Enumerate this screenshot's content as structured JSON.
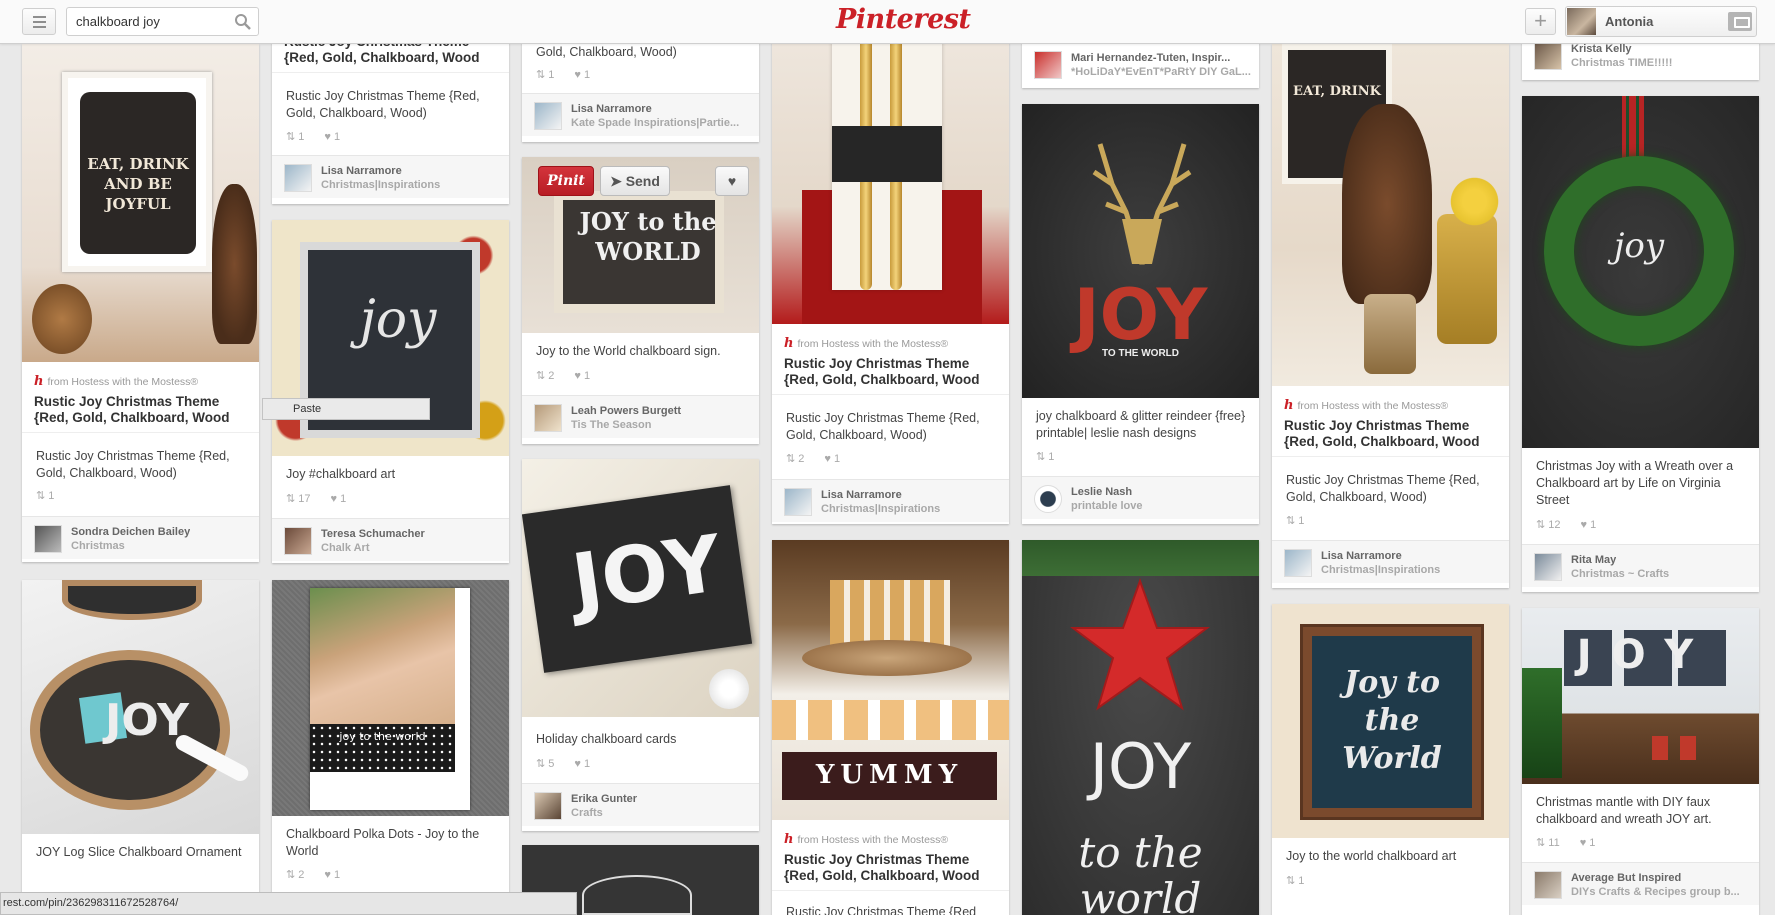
{
  "header": {
    "search_value": "chalkboard joy",
    "logo": "Pinterest",
    "user_name": "Antonia"
  },
  "hover_actions": {
    "pin_it": "Pinit",
    "send": "Send"
  },
  "paste_tooltip": "Paste",
  "status_url": "rest.com/pin/236298311672528764/",
  "pins": {
    "c1a": {
      "source": "from Hostess with the Mostess®",
      "title": "Rustic Joy Christmas Theme {Red, Gold, Chalkboard, Wood",
      "desc": "Rustic Joy Christmas Theme {Red, Gold, Chalkboard, Wood)",
      "repins": "1",
      "user": "Sondra Deichen Bailey",
      "board": "Christmas",
      "img_text": "EAT, DRINK AND BE JOYFUL"
    },
    "c1b": {
      "desc": "JOY Log Slice Chalkboard Ornament",
      "img_text": "JOY"
    },
    "c2a": {
      "title": "Rustic Joy Christmas Theme {Red, Gold, Chalkboard, Wood",
      "desc": "Rustic Joy Christmas Theme {Red, Gold, Chalkboard, Wood)",
      "repins": "1",
      "likes": "1",
      "user": "Lisa Narramore",
      "board": "Christmas|Inspirations"
    },
    "c2b": {
      "desc": "Joy #chalkboard art",
      "repins": "17",
      "likes": "1",
      "user": "Teresa Schumacher",
      "board": "Chalk Art",
      "img_text": "joy"
    },
    "c2c": {
      "desc": "Chalkboard Polka Dots - Joy to the World",
      "repins": "2",
      "likes": "1",
      "img_text": "joy to the world"
    },
    "c3a": {
      "desc": "Gold, Chalkboard, Wood)",
      "repins": "1",
      "likes": "1",
      "user": "Lisa Narramore",
      "board": "Kate Spade Inspirations|Partie..."
    },
    "c3b": {
      "desc": "Joy to the World chalkboard sign.",
      "repins": "2",
      "likes": "1",
      "user": "Leah Powers Burgett",
      "board": "Tis The Season",
      "img_text": "JOY to the WORLD"
    },
    "c3c": {
      "desc": "Holiday chalkboard cards",
      "repins": "5",
      "likes": "1",
      "user": "Erika Gunter",
      "board": "Crafts",
      "img_text": "JOY"
    },
    "c4a": {
      "source": "from Hostess with the Mostess®",
      "title": "Rustic Joy Christmas Theme {Red, Gold, Chalkboard, Wood",
      "desc": "Rustic Joy Christmas Theme {Red, Gold, Chalkboard, Wood)",
      "repins": "2",
      "likes": "1",
      "user": "Lisa Narramore",
      "board": "Christmas|Inspirations"
    },
    "c4b": {
      "source": "from Hostess with the Mostess®",
      "title": "Rustic Joy Christmas Theme {Red, Gold, Chalkboard, Wood",
      "desc": "Rustic Joy Christmas Theme {Red",
      "img_text": "YUMMY"
    },
    "c5a": {
      "user": "Mari Hernandez-Tuten, Inspir...",
      "board": "*HoLiDaY*EvEnT*PaRtY DIY GaL..."
    },
    "c5b": {
      "desc": "joy chalkboard & glitter reindeer {free} printable| leslie nash designs",
      "repins": "1",
      "user": "Leslie Nash",
      "board": "printable love",
      "img_text": "JOY",
      "img_sub": "TO THE WORLD"
    },
    "c5c": {
      "img_text": "JOY",
      "img_sub": "to the world"
    },
    "c6a": {
      "source": "from Hostess with the Mostess®",
      "title": "Rustic Joy Christmas Theme {Red, Gold, Chalkboard, Wood",
      "desc": "Rustic Joy Christmas Theme {Red, Gold, Chalkboard, Wood)",
      "repins": "1",
      "user": "Lisa Narramore",
      "board": "Christmas|Inspirations",
      "img_text": "EAT, DRINK"
    },
    "c6b": {
      "desc": "Joy to the world chalkboard art",
      "repins": "1",
      "img_text": "Joy to the World"
    },
    "c7a": {
      "user": "Krista Kelly",
      "board": "Christmas TIME!!!!!"
    },
    "c7b": {
      "desc": "Christmas Joy with a Wreath over a Chalkboard art by Life on Virginia Street",
      "repins": "12",
      "likes": "1",
      "user": "Rita May",
      "board": "Christmas ~ Crafts",
      "img_text": "joy"
    },
    "c7c": {
      "desc": "Christmas mantle with DIY faux chalkboard and wreath JOY art.",
      "repins": "11",
      "likes": "1",
      "user": "Average But Inspired",
      "board": "DIYs Crafts & Recipes group b...",
      "img_text": "JOY"
    }
  }
}
